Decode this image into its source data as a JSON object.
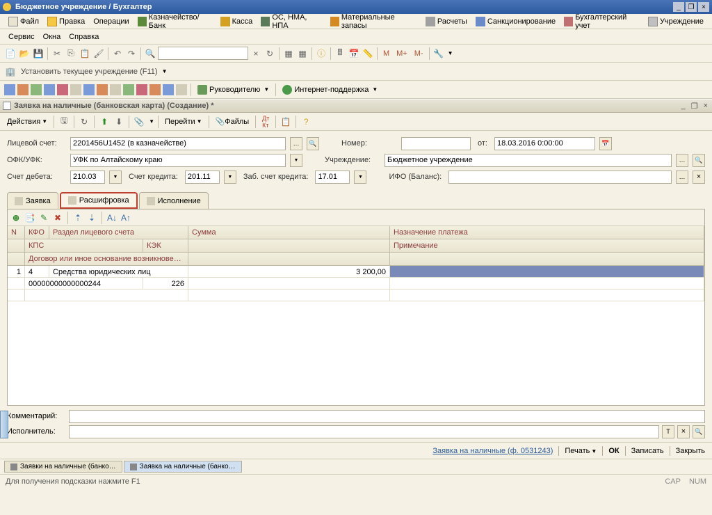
{
  "title_bar": {
    "text": "Бюджетное учреждение / Бухгалтер"
  },
  "main_menu": {
    "row1": [
      {
        "label": "Файл",
        "icon": "mi-doc"
      },
      {
        "label": "Правка",
        "icon": "mi-folder"
      },
      {
        "label": "Операции",
        "icon": "mi-gear"
      },
      {
        "label": "Казначейство/Банк",
        "icon": "mi-bank"
      },
      {
        "label": "Касса",
        "icon": "mi-cash"
      },
      {
        "label": "ОС, НМА, НПА",
        "icon": "mi-os"
      },
      {
        "label": "Материальные запасы",
        "icon": "mi-mat"
      },
      {
        "label": "Расчеты",
        "icon": "mi-calc"
      },
      {
        "label": "Санкционирование",
        "icon": "mi-sanc"
      },
      {
        "label": "Бухгалтерский учет",
        "icon": "mi-book"
      },
      {
        "label": "Учреждение",
        "icon": "mi-org"
      }
    ],
    "row2": [
      {
        "label": "Сервис"
      },
      {
        "label": "Окна"
      },
      {
        "label": "Справка"
      }
    ]
  },
  "tb2_labels": {
    "m": "М",
    "mplus": "М+",
    "mminus": "М-"
  },
  "inst_bar": {
    "label": "Установить текущее учреждение (F11)"
  },
  "row3": {
    "link1": "Руководителю",
    "link2": "Интернет-поддержка"
  },
  "doc": {
    "title": "Заявка на наличные (банковская карта) (Создание) *",
    "actions_label": "Действия",
    "goto_label": "Перейти",
    "files_label": "Файлы"
  },
  "form": {
    "account_label": "Лицевой счет:",
    "account_value": "2201456U1452 (в казначействе)",
    "number_label": "Номер:",
    "from_label": "от:",
    "date_value": "18.03.2016 0:00:00",
    "ofk_label": "ОФК/УФК:",
    "ofk_value": "УФК по Алтайскому краю",
    "org_label": "Учреждение:",
    "org_value": "Бюджетное учреждение",
    "debit_label": "Счет дебета:",
    "debit_value": "210.03",
    "credit_label": "Счет кредита:",
    "credit_value": "201.11",
    "zab_label": "Заб. счет кредита:",
    "zab_value": "17.01",
    "ifo_label": "ИФО (Баланс):"
  },
  "tabs": {
    "t1": "Заявка",
    "t2": "Расшифровка",
    "t3": "Исполнение"
  },
  "grid": {
    "headers": {
      "n": "N",
      "kfo": "КФО",
      "razdel": "Раздел лицевого счета",
      "kps": "КПС",
      "kek": "КЭК",
      "dogovor": "Договор или иное основание возникнове…",
      "sum": "Сумма",
      "naz": "Назначение платежа",
      "note": "Примечание"
    },
    "rows": [
      {
        "n": "1",
        "kfo": "4",
        "razdel": "Средства юридических лиц",
        "kps": "00000000000000244",
        "kek": "226",
        "sum": "3 200,00"
      }
    ]
  },
  "comments": {
    "comment_label": "Комментарий:",
    "executor_label": "Исполнитель:"
  },
  "footer": {
    "form_link": "Заявка на наличные (ф. 0531243)",
    "print": "Печать",
    "ok": "ОК",
    "save": "Записать",
    "close": "Закрыть"
  },
  "bottom_tabs": {
    "t1": "Заявки на наличные (банко…",
    "t2": "Заявка на наличные (банко…"
  },
  "status": {
    "hint": "Для получения подсказки нажмите F1",
    "cap": "CAP",
    "num": "NUM"
  }
}
